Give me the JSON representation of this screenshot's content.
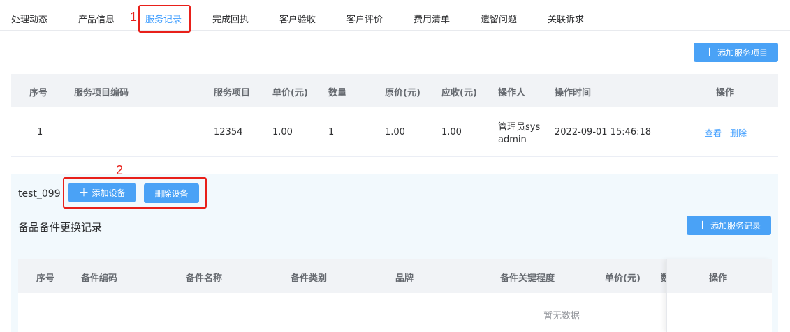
{
  "tabs": [
    "处理动态",
    "产品信息",
    "服务记录",
    "完成回执",
    "客户验收",
    "客户评价",
    "费用清单",
    "遗留问题",
    "关联诉求"
  ],
  "active_tab": "服务记录",
  "annotations": {
    "one": "1",
    "two": "2"
  },
  "service_record": {
    "add_button": "添加服务项目",
    "columns": [
      "序号",
      "服务项目编码",
      "服务项目",
      "单价(元)",
      "数量",
      "原价(元)",
      "应收(元)",
      "操作人",
      "操作时间",
      "操作"
    ],
    "rows": [
      {
        "index": "1",
        "code": "",
        "item": "12354",
        "unit_price": "1.00",
        "quantity": "1",
        "original_price": "1.00",
        "receivable": "1.00",
        "operator_line1": "管理员sys",
        "operator_line2": "admin",
        "time": "2022-09-01 15:46:18",
        "view": "查看",
        "delete": "删除"
      }
    ]
  },
  "device": {
    "name": "test_099",
    "add_button": "添加设备",
    "delete_button": "删除设备"
  },
  "parts": {
    "title": "备品备件更换记录",
    "add_button": "添加服务记录",
    "columns": [
      "序号",
      "备件编码",
      "备件名称",
      "备件类别",
      "品牌",
      "备件关键程度",
      "单价(元)",
      "数",
      "操作"
    ],
    "empty_text": "暂无数据"
  },
  "colors": {
    "accent": "#409eff",
    "button": "#4aa2f6",
    "annotation": "#e8201a",
    "section_bg": "#f2f9fd"
  }
}
